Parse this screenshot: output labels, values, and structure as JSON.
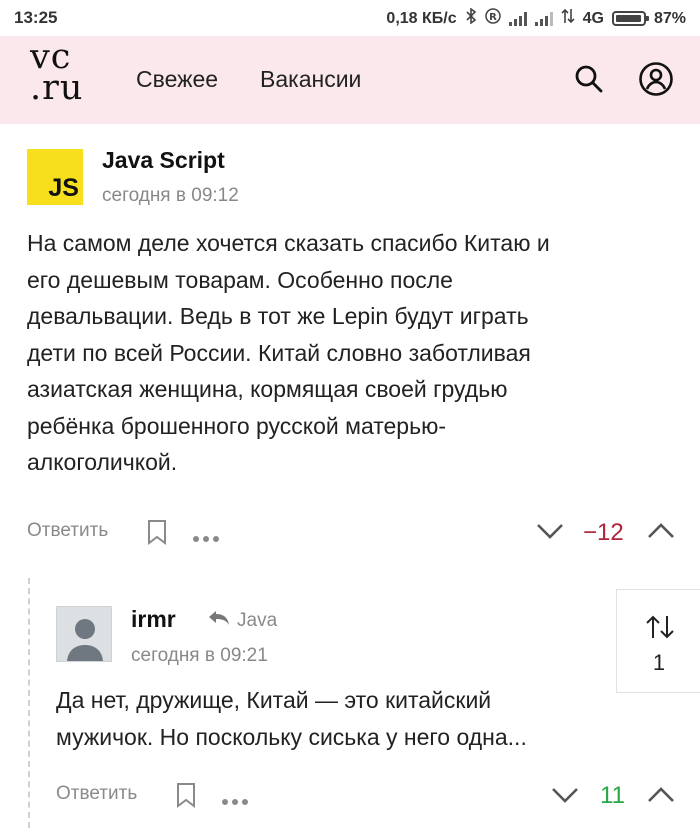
{
  "status_bar": {
    "time": "13:25",
    "net_speed": "0,18 КБ/с",
    "network": "4G",
    "battery": "87%"
  },
  "header": {
    "logo": [
      "vc",
      ".ru"
    ],
    "nav": [
      "Свежее",
      "Вакансии"
    ],
    "bg_color": "#fbe8ec"
  },
  "comments": [
    {
      "author": "Java Script",
      "avatar_text": "JS",
      "date": "сегодня в 09:12",
      "text_lines": [
        "На самом деле хочется сказать спасибо Китаю и",
        "его дешевым товарам. Особенно после",
        "девальвации. Ведь в тот же Lepin будут играть",
        "дети по всей России. Китай словно заботливая",
        "азиатская женщина, кормящая своей грудью",
        "ребёнка брошенного русской матерью-",
        "алкоголичкой."
      ],
      "reply_label": "Ответить",
      "score": "−12",
      "score_color": "#b0243b"
    },
    {
      "author": "irmr",
      "reply_to": "Java",
      "date": "сегодня в 09:21",
      "text_lines": [
        "Да нет, дружище, Китай — это китайский",
        "мужичок. Но поскольку сиська у него одна..."
      ],
      "reply_label": "Ответить",
      "score": "11",
      "score_color": "#28a745"
    }
  ],
  "rating_card": {
    "icon": "sort-arrows-icon",
    "value": "1"
  }
}
